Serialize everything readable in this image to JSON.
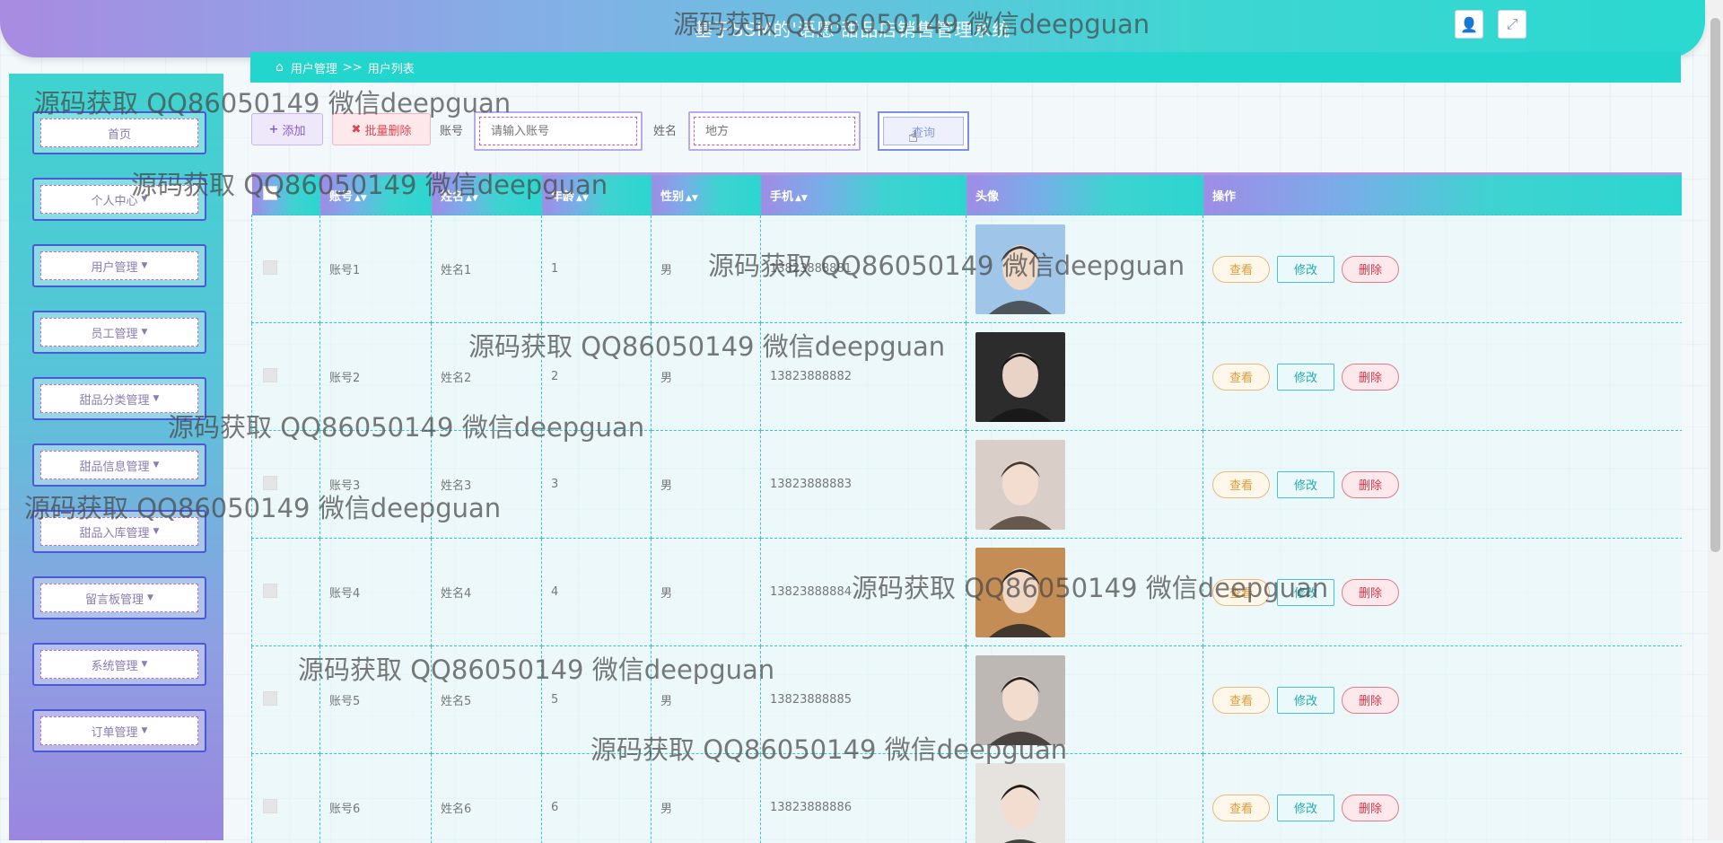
{
  "header": {
    "title": "基于SSM的'语愿'甜品店销售管理系统",
    "user_icon": "user-icon",
    "fullscreen_icon": "fullscreen-icon"
  },
  "sidebar": {
    "items": [
      {
        "label": "首页",
        "has_caret": false
      },
      {
        "label": "个人中心",
        "has_caret": true
      },
      {
        "label": "用户管理",
        "has_caret": true
      },
      {
        "label": "员工管理",
        "has_caret": true
      },
      {
        "label": "甜品分类管理",
        "has_caret": true
      },
      {
        "label": "甜品信息管理",
        "has_caret": true
      },
      {
        "label": "甜品入库管理",
        "has_caret": true
      },
      {
        "label": "留言板管理",
        "has_caret": true
      },
      {
        "label": "系统管理",
        "has_caret": true
      },
      {
        "label": "订单管理",
        "has_caret": true
      }
    ]
  },
  "breadcrumb": {
    "section": "用户管理",
    "separator": ">>",
    "page": "用户列表"
  },
  "toolbar": {
    "add_label": "添加",
    "batch_delete_label": "批量删除",
    "account_label": "账号",
    "account_placeholder": "请输入账号",
    "name_label": "姓名",
    "name_placeholder": "地方",
    "search_label": "查询"
  },
  "table": {
    "columns": [
      "账号",
      "姓名",
      "年龄",
      "性别",
      "手机",
      "头像",
      "操作"
    ],
    "rows": [
      {
        "account": "账号1",
        "name": "姓名1",
        "age": "1",
        "gender": "男",
        "phone": "13823888881"
      },
      {
        "account": "账号2",
        "name": "姓名2",
        "age": "2",
        "gender": "男",
        "phone": "13823888882"
      },
      {
        "account": "账号3",
        "name": "姓名3",
        "age": "3",
        "gender": "男",
        "phone": "13823888883"
      },
      {
        "account": "账号4",
        "name": "姓名4",
        "age": "4",
        "gender": "男",
        "phone": "13823888884"
      },
      {
        "account": "账号5",
        "name": "姓名5",
        "age": "5",
        "gender": "男",
        "phone": "13823888885"
      },
      {
        "account": "账号6",
        "name": "姓名6",
        "age": "6",
        "gender": "男",
        "phone": "13823888886"
      }
    ],
    "actions": {
      "view": "查看",
      "edit": "修改",
      "delete": "删除"
    }
  },
  "watermark": "源码获取 QQ86050149 微信deepguan",
  "colors": {
    "accent_teal": "#22d6cd",
    "accent_purple": "#a88be2",
    "delete_red": "#d9384c",
    "view_orange": "#e29a3a"
  }
}
